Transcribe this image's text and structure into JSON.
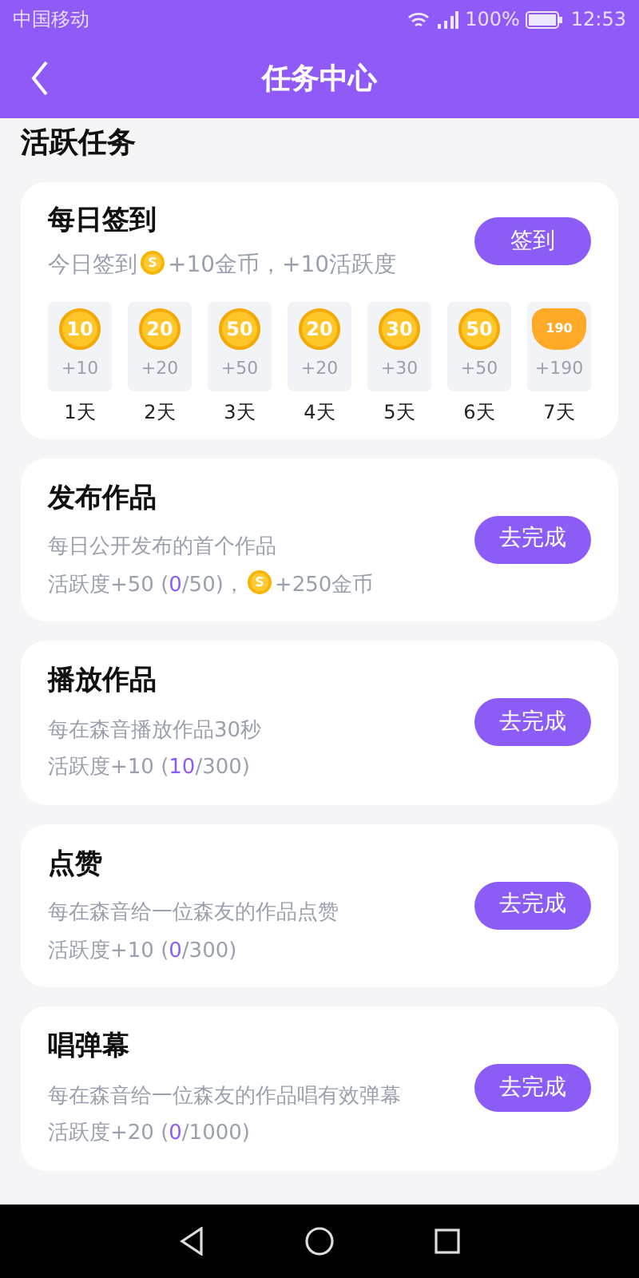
{
  "status_bar": {
    "carrier": "中国移动",
    "battery": "100%",
    "time": "12:53"
  },
  "header": {
    "title": "任务中心"
  },
  "section_title": "活跃任务",
  "daily_checkin": {
    "title": "每日签到",
    "desc_prefix": "今日签到",
    "desc_suffix": "+10金币，+10活跃度",
    "button": "签到",
    "days": [
      {
        "kind": "coin",
        "amount": "10",
        "reward": "+10",
        "label": "1天"
      },
      {
        "kind": "coin",
        "amount": "20",
        "reward": "+20",
        "label": "2天"
      },
      {
        "kind": "coin",
        "amount": "50",
        "reward": "+50",
        "label": "3天"
      },
      {
        "kind": "coin",
        "amount": "20",
        "reward": "+20",
        "label": "4天"
      },
      {
        "kind": "coin",
        "amount": "30",
        "reward": "+30",
        "label": "5天"
      },
      {
        "kind": "coin",
        "amount": "50",
        "reward": "+50",
        "label": "6天"
      },
      {
        "kind": "bag",
        "amount": "190",
        "reward": "+190",
        "label": "7天"
      }
    ]
  },
  "tasks": [
    {
      "title": "发布作品",
      "desc": "每日公开发布的首个作品",
      "progress_prefix": "活跃度+50 (",
      "progress_current": "0",
      "progress_suffix": "/50)，",
      "coin_reward": "+250金币",
      "button": "去完成"
    },
    {
      "title": "播放作品",
      "desc": "每在森音播放作品30秒",
      "progress_prefix": "活跃度+10 (",
      "progress_current": "10",
      "progress_suffix": "/300)",
      "button": "去完成"
    },
    {
      "title": "点赞",
      "desc": "每在森音给一位森友的作品点赞",
      "progress_prefix": "活跃度+10 (",
      "progress_current": "0",
      "progress_suffix": "/300)",
      "button": "去完成"
    },
    {
      "title": "唱弹幕",
      "desc": "每在森音给一位森友的作品唱有效弹幕",
      "progress_prefix": "活跃度+20 (",
      "progress_current": "0",
      "progress_suffix": "/1000)",
      "button": "去完成"
    }
  ]
}
